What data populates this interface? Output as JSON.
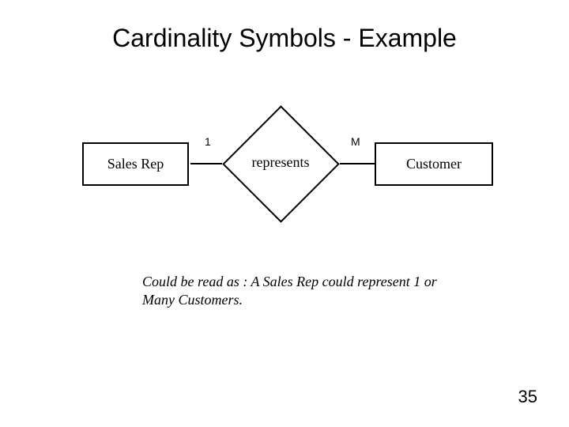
{
  "title": "Cardinality Symbols - Example",
  "diagram": {
    "entity_left": "Sales Rep",
    "entity_right": "Customer",
    "relationship": "represents",
    "cardinality_left": "1",
    "cardinality_right": "M"
  },
  "caption": "Could be read as : A Sales Rep could represent 1 or Many Customers.",
  "page_number": "35"
}
